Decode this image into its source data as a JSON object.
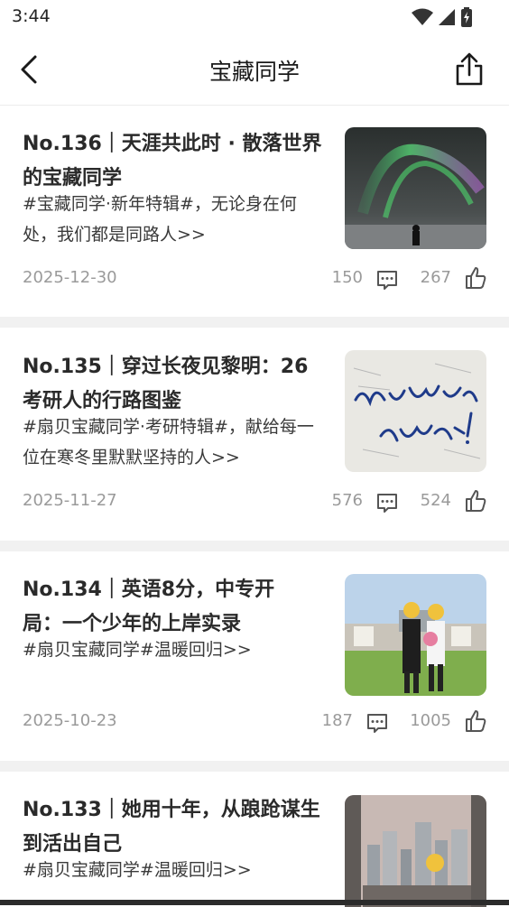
{
  "status": {
    "time": "3:44"
  },
  "nav": {
    "title": "宝藏同学"
  },
  "articles": [
    {
      "title": "No.136｜天涯共此时 · 散落世界的宝藏同学",
      "desc": "#宝藏同学·新年特辑#，无论身在何处，我们都是同路人>>",
      "date": "2025-12-30",
      "comments": "150",
      "likes": "267",
      "image": "aurora-photo"
    },
    {
      "title": "No.135｜穿过长夜见黎明：26考研人的行路图鉴",
      "desc": "#扇贝宝藏同学·考研特辑#，献给每一位在寒冬里默默坚持的人>>",
      "date": "2025-11-27",
      "comments": "576",
      "likes": "524",
      "image": "handwriting-photo"
    },
    {
      "title": "No.134｜英语8分，中专开局：一个少年的上岸实录",
      "desc": "#扇贝宝藏同学#温暖回归>>",
      "date": "2025-10-23",
      "comments": "187",
      "likes": "1005",
      "image": "graduation-photo"
    },
    {
      "title": "No.133｜她用十年，从踉跄谋生到活出自己",
      "desc": "#扇贝宝藏同学#温暖回归>>",
      "date": "",
      "comments": "",
      "likes": "",
      "image": "city-photo"
    }
  ]
}
